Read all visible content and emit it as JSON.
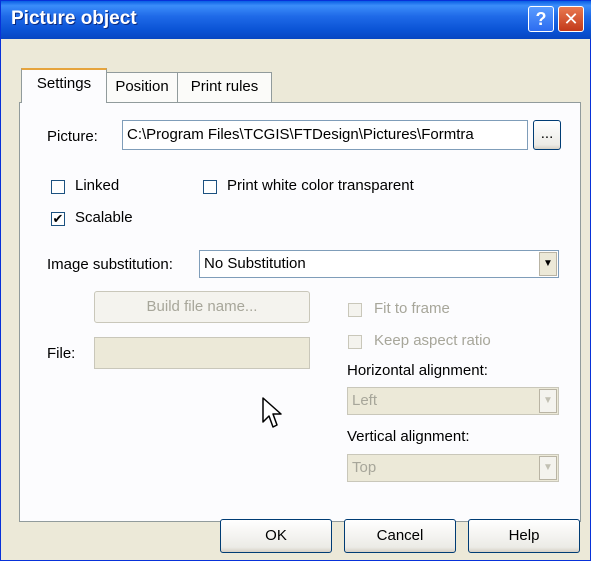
{
  "window": {
    "title": "Picture object"
  },
  "tabs": [
    {
      "label": "Settings",
      "active": true
    },
    {
      "label": "Position",
      "active": false
    },
    {
      "label": "Print rules",
      "active": false
    }
  ],
  "picture": {
    "label": "Picture:",
    "value": "C:\\Program Files\\TCGIS\\FTDesign\\Pictures\\Formtra",
    "browse_label": "..."
  },
  "options": {
    "linked": {
      "label": "Linked",
      "checked": false
    },
    "print_white_transparent": {
      "label": "Print white color transparent",
      "checked": false
    },
    "scalable": {
      "label": "Scalable",
      "checked": true
    }
  },
  "image_substitution": {
    "label": "Image substitution:",
    "value": "No Substitution"
  },
  "build_file_name": {
    "label": "Build file name..."
  },
  "file": {
    "label": "File:",
    "value": ""
  },
  "fit_to_frame": {
    "label": "Fit to frame",
    "checked": false
  },
  "keep_aspect_ratio": {
    "label": "Keep aspect ratio",
    "checked": false
  },
  "horizontal_alignment": {
    "label": "Horizontal alignment:",
    "value": "Left"
  },
  "vertical_alignment": {
    "label": "Vertical alignment:",
    "value": "Top"
  },
  "buttons": {
    "ok": "OK",
    "cancel": "Cancel",
    "help": "Help"
  },
  "check_mark": "✔",
  "title_buttons": {
    "help": "?",
    "close": "✕"
  }
}
